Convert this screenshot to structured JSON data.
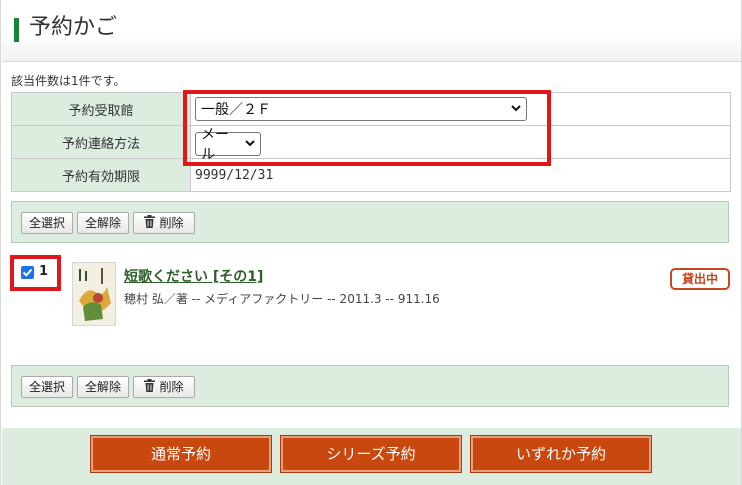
{
  "header": {
    "title": "予約かご"
  },
  "result_count": "該当件数は1件です。",
  "reservation_form": {
    "pickup_label": "予約受取館",
    "pickup_value": "一般／２Ｆ",
    "contact_label": "予約連絡方法",
    "contact_value": "メール",
    "expiry_label": "予約有効期限",
    "expiry_value": "9999/12/31"
  },
  "toolbar": {
    "select_all": "全選択",
    "deselect_all": "全解除",
    "delete": "削除"
  },
  "items": [
    {
      "number": "1",
      "checked": true,
      "title": "短歌ください [その1]",
      "meta": "穂村 弘／著 -- メディアファクトリー -- 2011.3 -- 911.16",
      "status": "貸出中"
    }
  ],
  "actions": {
    "normal": "通常予約",
    "series": "シリーズ予約",
    "either": "いずれか予約"
  },
  "colors": {
    "accent_green": "#17823a",
    "panel_green": "#dcecdf",
    "action_orange": "#c9480f",
    "highlight_red": "#e0161c"
  }
}
